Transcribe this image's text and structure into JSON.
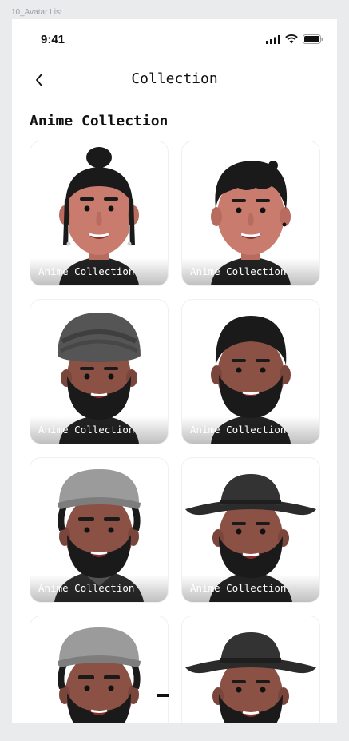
{
  "frame_label": "10_Avatar List",
  "status_bar": {
    "time": "9:41"
  },
  "nav": {
    "title": "Collection"
  },
  "section": {
    "title": "Anime Collection"
  },
  "cards": [
    {
      "label": "Anime Collection",
      "avatar": "bun-hair-earrings"
    },
    {
      "label": "Anime Collection",
      "avatar": "short-hair"
    },
    {
      "label": "Anime Collection",
      "avatar": "turban-beard"
    },
    {
      "label": "Anime Collection",
      "avatar": "short-hair-beard"
    },
    {
      "label": "Anime Collection",
      "avatar": "grey-cap-beard"
    },
    {
      "label": "Anime Collection",
      "avatar": "wide-hat-beard"
    },
    {
      "label": "",
      "avatar": "grey-cap-beard"
    },
    {
      "label": "",
      "avatar": "wide-hat-beard"
    }
  ],
  "colors": {
    "skin": "#c97b6e",
    "hair": "#1a1a1a",
    "shirt": "#232323"
  }
}
